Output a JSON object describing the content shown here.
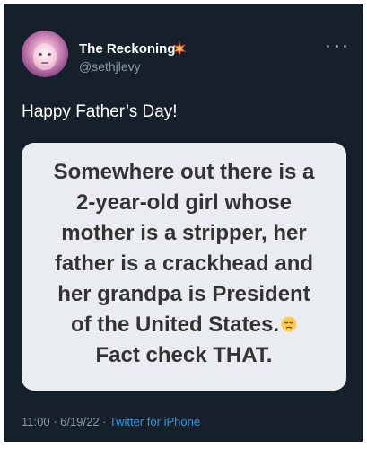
{
  "tweet": {
    "display_name": "The Reckoning",
    "handle": "@sethjlevy",
    "badge_icon": "collision-icon",
    "more_icon": "more-options-icon",
    "text": "Happy Father’s Day!",
    "media_lines": [
      "Somewhere out there is a",
      "2-year-old girl whose",
      "mother is a stripper, her",
      "father is a crackhead and",
      "her grandpa is President",
      "of the United States.",
      "Fact check THAT."
    ],
    "media_emoji": "pensive-face-icon",
    "time": "11:00",
    "date": "6/19/22",
    "separator": "·",
    "source": "Twitter for iPhone"
  },
  "colors": {
    "background": "#15202b",
    "primary_text": "#ffffff",
    "secondary_text": "#8899a6",
    "link": "#1d9bf0",
    "media_background": "#e9edf1",
    "media_text": "#333333"
  }
}
